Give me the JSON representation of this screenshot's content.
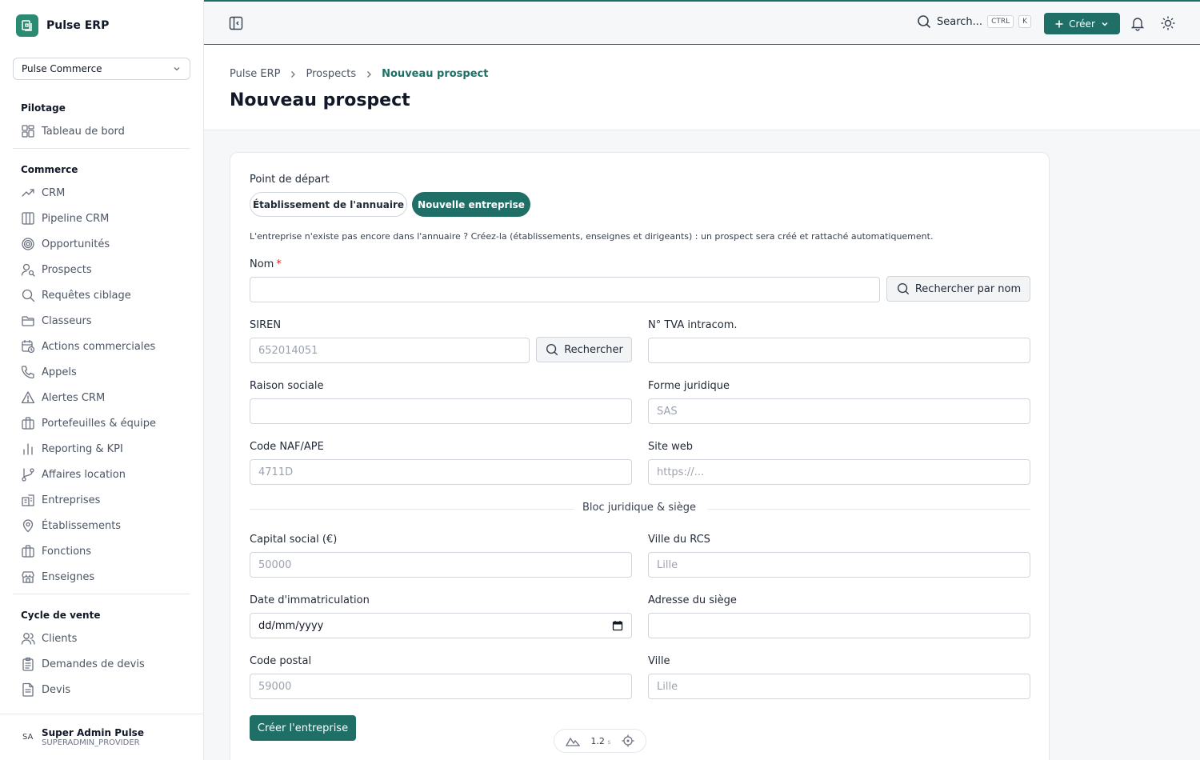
{
  "app": {
    "name": "Pulse ERP"
  },
  "org_select": {
    "value": "Pulse Commerce"
  },
  "nav": {
    "sections": [
      {
        "title": "Pilotage",
        "items": [
          {
            "label": "Tableau de bord",
            "icon": "dashboard-icon"
          }
        ]
      },
      {
        "title": "Commerce",
        "items": [
          {
            "label": "CRM",
            "icon": "trend-icon"
          },
          {
            "label": "Pipeline CRM",
            "icon": "columns-icon"
          },
          {
            "label": "Opportunités",
            "icon": "target-icon"
          },
          {
            "label": "Prospects",
            "icon": "user-search-icon"
          },
          {
            "label": "Requêtes ciblage",
            "icon": "search-icon"
          },
          {
            "label": "Classeurs",
            "icon": "folder-icon"
          },
          {
            "label": "Actions commerciales",
            "icon": "calendar-clock-icon"
          },
          {
            "label": "Appels",
            "icon": "phone-icon"
          },
          {
            "label": "Alertes CRM",
            "icon": "alert-icon"
          },
          {
            "label": "Portefeuilles & équipe",
            "icon": "briefcase-icon"
          },
          {
            "label": "Reporting & KPI",
            "icon": "bar-chart-icon"
          },
          {
            "label": "Affaires location",
            "icon": "git-branch-icon"
          },
          {
            "label": "Entreprises",
            "icon": "building-icon"
          },
          {
            "label": "Établissements",
            "icon": "map-pin-icon"
          },
          {
            "label": "Fonctions",
            "icon": "briefcase-icon"
          },
          {
            "label": "Enseignes",
            "icon": "store-icon"
          }
        ]
      },
      {
        "title": "Cycle de vente",
        "items": [
          {
            "label": "Clients",
            "icon": "users-icon"
          },
          {
            "label": "Demandes de devis",
            "icon": "clipboard-icon"
          },
          {
            "label": "Devis",
            "icon": "file-text-icon"
          }
        ]
      }
    ]
  },
  "user": {
    "initials": "SA",
    "name": "Super Admin Pulse",
    "role": "SUPERADMIN_PROVIDER"
  },
  "topbar": {
    "search_label": "Search...",
    "kbd_ctrl": "CTRL",
    "kbd_k": "K",
    "create_label": "Créer"
  },
  "breadcrumb": [
    "Pulse ERP",
    "Prospects",
    "Nouveau prospect"
  ],
  "page_title": "Nouveau prospect",
  "form": {
    "start_label": "Point de départ",
    "option_directory": "Établissement de l'annuaire",
    "option_new": "Nouvelle entreprise",
    "help": "L'entreprise n'existe pas encore dans l'annuaire ? Créez-la (établissements, enseignes et dirigeants) : un prospect sera créé et rattaché automatiquement.",
    "nom_label": "Nom",
    "nom_required": "*",
    "search_name_btn": "Rechercher par nom",
    "siren_label": "SIREN",
    "siren_placeholder": "652014051",
    "search_btn": "Rechercher",
    "tva_label": "N° TVA intracom.",
    "raison_label": "Raison sociale",
    "forme_label": "Forme juridique",
    "forme_placeholder": "SAS",
    "naf_label": "Code NAF/APE",
    "naf_placeholder": "4711D",
    "site_label": "Site web",
    "site_placeholder": "https://...",
    "section_title": "Bloc juridique & siège",
    "capital_label": "Capital social (€)",
    "capital_placeholder": "50000",
    "rcs_label": "Ville du RCS",
    "rcs_placeholder": "Lille",
    "date_label": "Date d'immatriculation",
    "date_placeholder": "dd/mm/yyyy",
    "adresse_label": "Adresse du siège",
    "cp_label": "Code postal",
    "cp_placeholder": "59000",
    "ville_label": "Ville",
    "ville_placeholder": "Lille",
    "submit": "Créer l'entreprise"
  },
  "floating": {
    "time": "1.2",
    "unit": "s"
  }
}
